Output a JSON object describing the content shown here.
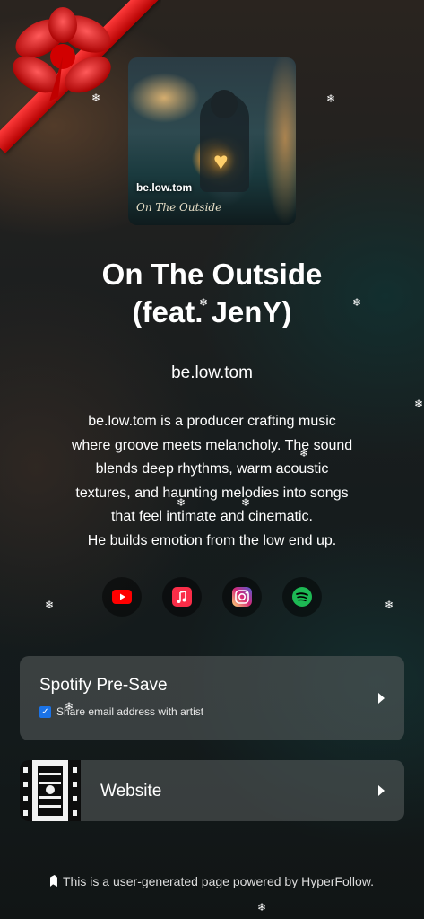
{
  "release": {
    "title_line1": "On The Outside",
    "title_line2": "(feat. JenY)",
    "artist": "be.low.tom",
    "cover_artist": "be.low.tom",
    "cover_title": "On The Outside"
  },
  "bio": [
    "be.low.tom is a producer crafting music",
    "where groove meets melancholy. The sound",
    "blends deep rhythms, warm acoustic",
    "textures, and haunting melodies into songs",
    "that feel intimate and cinematic.",
    "He builds emotion from the low end up."
  ],
  "socials": [
    {
      "icon": "youtube-icon",
      "color": "#ff0000"
    },
    {
      "icon": "apple-music-icon",
      "color": "#fa2d48"
    },
    {
      "icon": "instagram-icon",
      "color": "#e1306c"
    },
    {
      "icon": "spotify-icon",
      "color": "#1db954"
    }
  ],
  "presave": {
    "title": "Spotify Pre-Save",
    "checkbox_label": "Share email address with artist",
    "checked": true
  },
  "website": {
    "label": "Website"
  },
  "footer": {
    "text": "This is a user-generated page powered by HyperFollow."
  }
}
